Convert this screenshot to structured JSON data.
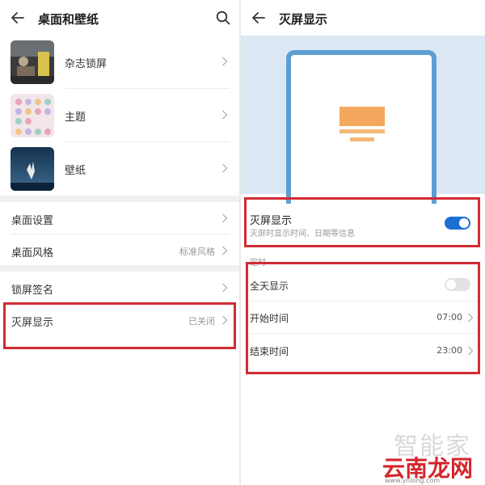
{
  "left": {
    "title": "桌面和壁纸",
    "thumb_items": [
      {
        "label": "杂志锁屏"
      },
      {
        "label": "主题"
      },
      {
        "label": "壁纸"
      }
    ],
    "settings": [
      {
        "label": "桌面设置",
        "value": ""
      },
      {
        "label": "桌面风格",
        "value": "标准风格"
      },
      {
        "label": "锁屏签名",
        "value": ""
      },
      {
        "label": "灭屏显示",
        "value": "已关闭"
      }
    ]
  },
  "right": {
    "title": "灭屏显示",
    "aod": {
      "label": "灭屏显示",
      "desc": "灭屏时显示时间、日期等信息",
      "enabled": true
    },
    "section_header": "定时",
    "rows": [
      {
        "label": "全天显示",
        "value": "",
        "toggle": false
      },
      {
        "label": "开始时间",
        "value": "07:00"
      },
      {
        "label": "结束时间",
        "value": "23:00"
      }
    ]
  },
  "watermark": {
    "top": "智能家",
    "main": "云南龙网",
    "bottom": "www.ynlong.com"
  },
  "colors": {
    "accent": "#1d6fd6",
    "highlight": "#d22b34",
    "preview_bg": "#dbe8f4",
    "phone_frame": "#5f9ed2",
    "aod_block": "#f3a85d"
  }
}
